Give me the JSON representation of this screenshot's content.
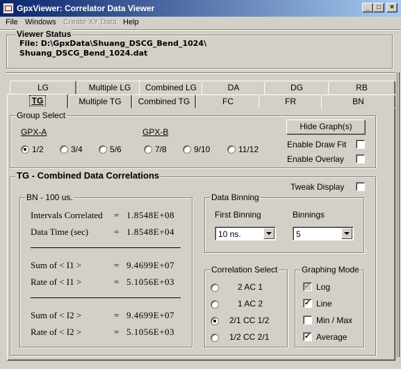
{
  "window": {
    "title": "GpxViewer: Correlator Data Viewer",
    "controls": {
      "minimize": "_",
      "maximize": "□",
      "close": "×"
    }
  },
  "menu": {
    "file": "File",
    "windows": "Windows",
    "create_xy": "Create XY Data",
    "help": "Help"
  },
  "status": {
    "title": "Viewer  Status",
    "line1": "File: D:\\GpxData\\Shuang_DSCG_Bend_1024\\",
    "line2": "Shuang_DSCG_Bend_1024.dat"
  },
  "tabs": {
    "back_row": [
      "LG",
      "Multiple LG",
      "Combined LG",
      "DA",
      "DG",
      "RB"
    ],
    "front_row": [
      "TG",
      "Multiple TG",
      "Combined TG",
      "FC",
      "FR",
      "BN"
    ],
    "active": "TG"
  },
  "group_select": {
    "title": "Group Select",
    "gpx_a": "GPX-A",
    "gpx_b": "GPX-B",
    "options": [
      "1/2",
      "3/4",
      "5/6",
      "7/8",
      "9/10",
      "11/12"
    ],
    "selected": "1/2",
    "hide_graph_button": "Hide Graph(s)",
    "enable_draw_fit": "Enable Draw Fit",
    "enable_overlay": "Enable Overlay"
  },
  "combined": {
    "title": "TG - Combined Data Correlations",
    "tweak_display": "Tweak Display",
    "bn_title": "BN - 100 us.",
    "rows": [
      {
        "label": "Intervals Correlated",
        "eq": "=",
        "value": "1.8548E+08"
      },
      {
        "label": "Data Time (sec)",
        "eq": "=",
        "value": "1.8548E+04"
      },
      {
        "label": "Sum  of  < I1 >",
        "eq": "=",
        "value": "9.4699E+07"
      },
      {
        "label": "Rate  of  < I1 >",
        "eq": "=",
        "value": "5.1056E+03"
      },
      {
        "label": "Sum  of  < I2 >",
        "eq": "=",
        "value": "9.4699E+07"
      },
      {
        "label": "Rate  of  < I2 >",
        "eq": "=",
        "value": "5.1056E+03"
      }
    ]
  },
  "data_binning": {
    "title": "Data Binning",
    "first_binning_label": "First Binning",
    "first_binning_value": "10 ns.",
    "binnings_label": "Binnings",
    "binnings_value": "5"
  },
  "correlation_select": {
    "title": "Correlation Select",
    "options": [
      "2  AC  1",
      "1  AC  2",
      "2/1  CC  1/2",
      "1/2  CC  2/1"
    ],
    "selected": "2/1  CC  1/2"
  },
  "graphing_mode": {
    "title": "Graphing  Mode",
    "options": [
      {
        "label": "Log",
        "checked": true,
        "disabled": true
      },
      {
        "label": "Line",
        "checked": true,
        "disabled": false
      },
      {
        "label": "Min / Max",
        "checked": false,
        "disabled": false
      },
      {
        "label": "Average",
        "checked": true,
        "disabled": false
      }
    ]
  },
  "colors": {
    "title_gradient_start": "#0a246a",
    "title_gradient_end": "#a6caf0",
    "face": "#d4d0c8"
  }
}
